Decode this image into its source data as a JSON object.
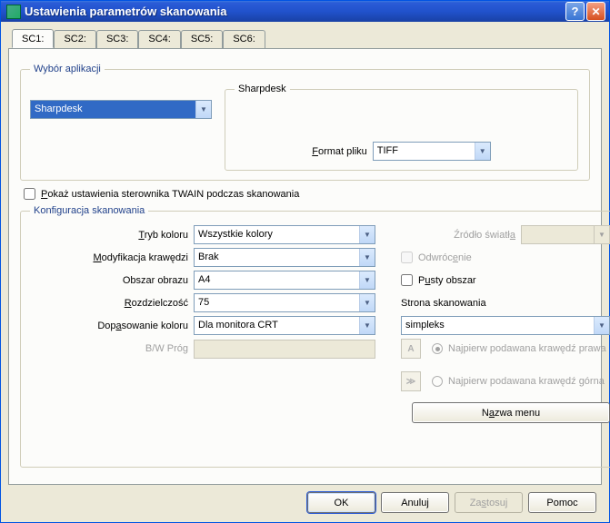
{
  "titlebar": {
    "title": "Ustawienia parametrów skanowania"
  },
  "tabs": [
    {
      "label": "SC1:"
    },
    {
      "label": "SC2:"
    },
    {
      "label": "SC3:"
    },
    {
      "label": "SC4:"
    },
    {
      "label": "SC5:"
    },
    {
      "label": "SC6:"
    }
  ],
  "app_selection": {
    "legend": "Wybór aplikacji",
    "selected_app": "Sharpdesk",
    "inner_legend": "Sharpdesk",
    "file_format_label_pre": "F",
    "file_format_label_post": "ormat pliku",
    "file_format_value": "TIFF"
  },
  "twain_checkbox": {
    "label_pre": "P",
    "label_post": "okaż ustawienia sterownika TWAIN podczas skanowania",
    "checked": false
  },
  "scan_config": {
    "legend": "Konfiguracja skanowania",
    "rows": {
      "color_mode": {
        "label_pre": "T",
        "label_post": "ryb koloru",
        "value": "Wszystkie kolory"
      },
      "edge_mod": {
        "label_pre": "M",
        "label_post": "odyfikacja krawędzi",
        "value": "Brak"
      },
      "image_area": {
        "label": "Obszar obrazu",
        "value": "A4"
      },
      "resolution": {
        "label_pre": "R",
        "label_post": "ozdzielczość",
        "value": "75"
      },
      "color_match": {
        "label_pre": "Dop",
        "label_underlined": "a",
        "label_post": "sowanie koloru",
        "value": "Dla monitora CRT"
      },
      "bw_thresh": {
        "label": "B/W Próg"
      }
    },
    "right": {
      "light_source_label_pre": "Źródło światł",
      "light_source_label_under": "a",
      "invert_label_pre": "Odwróc",
      "invert_label_under": "e",
      "invert_label_post": "nie",
      "empty_area_label_pre": "P",
      "empty_area_label_under": "u",
      "empty_area_label_post": "sty obszar",
      "scan_side_legend": "Strona skanowania",
      "scan_side_value": "simpleks",
      "icon_a": "A",
      "icon_b": "≫",
      "radio1_label": "Najpierw podawana krawędź prawa",
      "radio2_label": "Najpierw podawana krawędź górna",
      "menu_name_button_pre": "N",
      "menu_name_button_under": "a",
      "menu_name_button_post": "zwa menu"
    }
  },
  "footer": {
    "ok": "OK",
    "cancel": "Anuluj",
    "apply_pre": "Za",
    "apply_under": "s",
    "apply_post": "tosuj",
    "help": "Pomoc"
  }
}
